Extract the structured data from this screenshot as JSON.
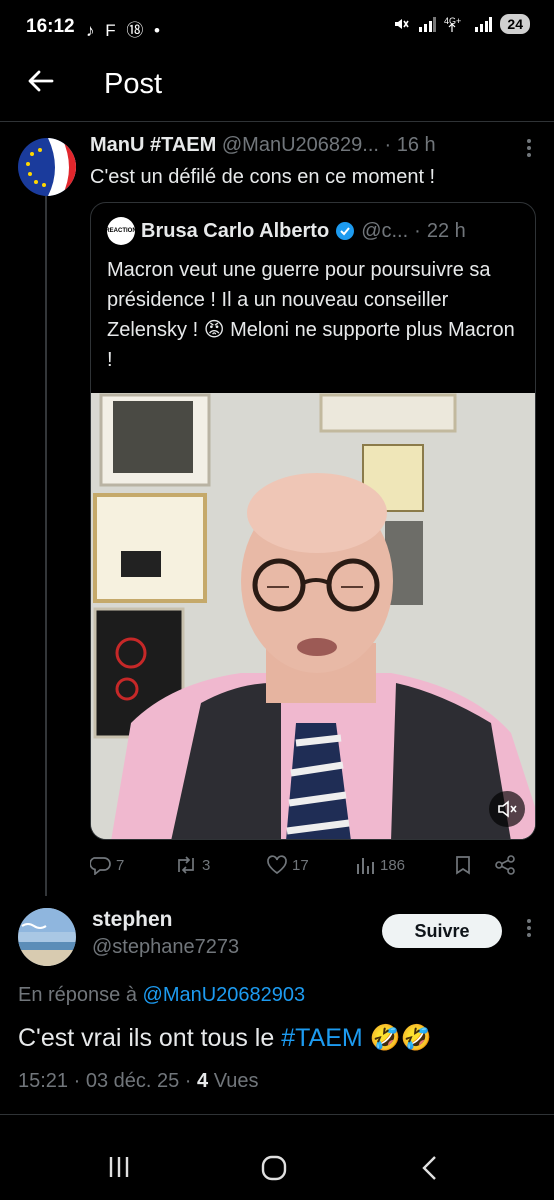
{
  "status_bar": {
    "time": "16:12",
    "notif_icons": "♪ F ⑱ •",
    "battery": "24"
  },
  "header": {
    "title": "Post"
  },
  "parent_tweet": {
    "name": "ManU #TAEM",
    "handle": "@ManU206829...",
    "sep": " · ",
    "time": "16 h",
    "text": "C'est un défilé de cons en ce moment !",
    "quote": {
      "avatar_text": "REACTION",
      "name": "Brusa Carlo Alberto",
      "handle": "@c...",
      "sep": " · ",
      "time": "22 h",
      "text": "Macron veut une guerre pour poursuivre sa présidence ! Il a un nouveau conseiller Zelensky ! 😡 Meloni ne supporte plus Macron !"
    },
    "actions": {
      "replies": "7",
      "reposts": "3",
      "likes": "17",
      "views": "186"
    }
  },
  "reply": {
    "name": "stephen",
    "handle": "@stephane7273",
    "follow_label": "Suivre",
    "in_reply_prefix": "En réponse à ",
    "in_reply_handle": "@ManU20682903",
    "text_main": "C'est vrai ils ont tous le ",
    "hashtag": "#TAEM",
    "emojis": " 🤣🤣",
    "timestamp": "15:21 · 03 déc. 25 · ",
    "views_count": "4",
    "views_label": " Vues"
  },
  "colors": {
    "accent": "#1d9bf0",
    "muted": "#71767b",
    "text": "#e7e9ea",
    "background": "#000000"
  }
}
